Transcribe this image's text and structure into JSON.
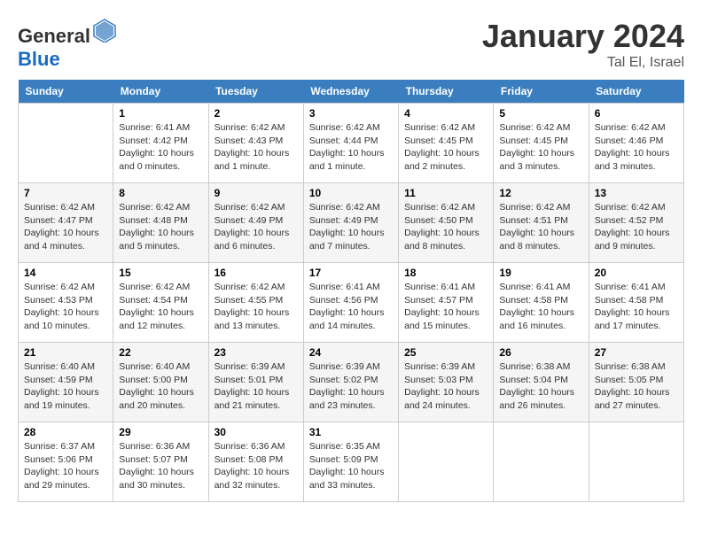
{
  "logo": {
    "text_general": "General",
    "text_blue": "Blue"
  },
  "header": {
    "month_year": "January 2024",
    "location": "Tal El, Israel"
  },
  "weekdays": [
    "Sunday",
    "Monday",
    "Tuesday",
    "Wednesday",
    "Thursday",
    "Friday",
    "Saturday"
  ],
  "weeks": [
    [
      {
        "day": "",
        "info": ""
      },
      {
        "day": "1",
        "info": "Sunrise: 6:41 AM\nSunset: 4:42 PM\nDaylight: 10 hours\nand 0 minutes."
      },
      {
        "day": "2",
        "info": "Sunrise: 6:42 AM\nSunset: 4:43 PM\nDaylight: 10 hours\nand 1 minute."
      },
      {
        "day": "3",
        "info": "Sunrise: 6:42 AM\nSunset: 4:44 PM\nDaylight: 10 hours\nand 1 minute."
      },
      {
        "day": "4",
        "info": "Sunrise: 6:42 AM\nSunset: 4:45 PM\nDaylight: 10 hours\nand 2 minutes."
      },
      {
        "day": "5",
        "info": "Sunrise: 6:42 AM\nSunset: 4:45 PM\nDaylight: 10 hours\nand 3 minutes."
      },
      {
        "day": "6",
        "info": "Sunrise: 6:42 AM\nSunset: 4:46 PM\nDaylight: 10 hours\nand 3 minutes."
      }
    ],
    [
      {
        "day": "7",
        "info": "Sunrise: 6:42 AM\nSunset: 4:47 PM\nDaylight: 10 hours\nand 4 minutes."
      },
      {
        "day": "8",
        "info": "Sunrise: 6:42 AM\nSunset: 4:48 PM\nDaylight: 10 hours\nand 5 minutes."
      },
      {
        "day": "9",
        "info": "Sunrise: 6:42 AM\nSunset: 4:49 PM\nDaylight: 10 hours\nand 6 minutes."
      },
      {
        "day": "10",
        "info": "Sunrise: 6:42 AM\nSunset: 4:49 PM\nDaylight: 10 hours\nand 7 minutes."
      },
      {
        "day": "11",
        "info": "Sunrise: 6:42 AM\nSunset: 4:50 PM\nDaylight: 10 hours\nand 8 minutes."
      },
      {
        "day": "12",
        "info": "Sunrise: 6:42 AM\nSunset: 4:51 PM\nDaylight: 10 hours\nand 8 minutes."
      },
      {
        "day": "13",
        "info": "Sunrise: 6:42 AM\nSunset: 4:52 PM\nDaylight: 10 hours\nand 9 minutes."
      }
    ],
    [
      {
        "day": "14",
        "info": "Sunrise: 6:42 AM\nSunset: 4:53 PM\nDaylight: 10 hours\nand 10 minutes."
      },
      {
        "day": "15",
        "info": "Sunrise: 6:42 AM\nSunset: 4:54 PM\nDaylight: 10 hours\nand 12 minutes."
      },
      {
        "day": "16",
        "info": "Sunrise: 6:42 AM\nSunset: 4:55 PM\nDaylight: 10 hours\nand 13 minutes."
      },
      {
        "day": "17",
        "info": "Sunrise: 6:41 AM\nSunset: 4:56 PM\nDaylight: 10 hours\nand 14 minutes."
      },
      {
        "day": "18",
        "info": "Sunrise: 6:41 AM\nSunset: 4:57 PM\nDaylight: 10 hours\nand 15 minutes."
      },
      {
        "day": "19",
        "info": "Sunrise: 6:41 AM\nSunset: 4:58 PM\nDaylight: 10 hours\nand 16 minutes."
      },
      {
        "day": "20",
        "info": "Sunrise: 6:41 AM\nSunset: 4:58 PM\nDaylight: 10 hours\nand 17 minutes."
      }
    ],
    [
      {
        "day": "21",
        "info": "Sunrise: 6:40 AM\nSunset: 4:59 PM\nDaylight: 10 hours\nand 19 minutes."
      },
      {
        "day": "22",
        "info": "Sunrise: 6:40 AM\nSunset: 5:00 PM\nDaylight: 10 hours\nand 20 minutes."
      },
      {
        "day": "23",
        "info": "Sunrise: 6:39 AM\nSunset: 5:01 PM\nDaylight: 10 hours\nand 21 minutes."
      },
      {
        "day": "24",
        "info": "Sunrise: 6:39 AM\nSunset: 5:02 PM\nDaylight: 10 hours\nand 23 minutes."
      },
      {
        "day": "25",
        "info": "Sunrise: 6:39 AM\nSunset: 5:03 PM\nDaylight: 10 hours\nand 24 minutes."
      },
      {
        "day": "26",
        "info": "Sunrise: 6:38 AM\nSunset: 5:04 PM\nDaylight: 10 hours\nand 26 minutes."
      },
      {
        "day": "27",
        "info": "Sunrise: 6:38 AM\nSunset: 5:05 PM\nDaylight: 10 hours\nand 27 minutes."
      }
    ],
    [
      {
        "day": "28",
        "info": "Sunrise: 6:37 AM\nSunset: 5:06 PM\nDaylight: 10 hours\nand 29 minutes."
      },
      {
        "day": "29",
        "info": "Sunrise: 6:36 AM\nSunset: 5:07 PM\nDaylight: 10 hours\nand 30 minutes."
      },
      {
        "day": "30",
        "info": "Sunrise: 6:36 AM\nSunset: 5:08 PM\nDaylight: 10 hours\nand 32 minutes."
      },
      {
        "day": "31",
        "info": "Sunrise: 6:35 AM\nSunset: 5:09 PM\nDaylight: 10 hours\nand 33 minutes."
      },
      {
        "day": "",
        "info": ""
      },
      {
        "day": "",
        "info": ""
      },
      {
        "day": "",
        "info": ""
      }
    ]
  ]
}
